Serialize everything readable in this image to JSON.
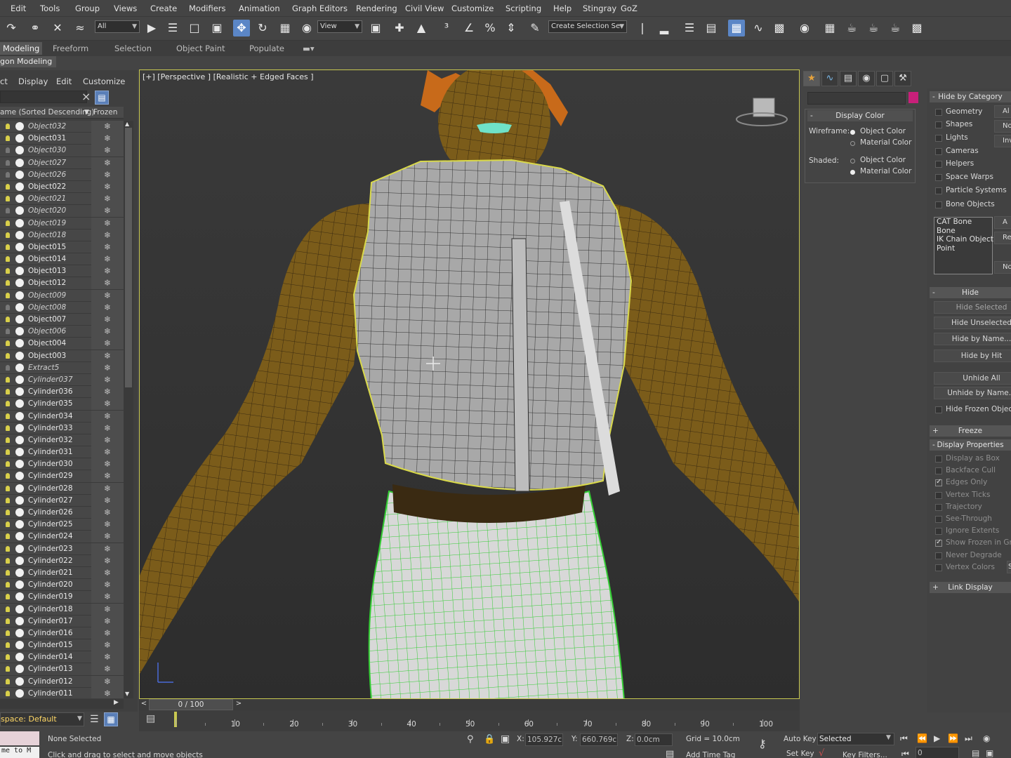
{
  "menu": [
    "Edit",
    "Tools",
    "Group",
    "Views",
    "Create",
    "Modifiers",
    "Animation",
    "Graph Editors",
    "Rendering",
    "Civil View",
    "Customize",
    "Scripting",
    "Help",
    "Stingray",
    "GoZ"
  ],
  "toolbar": {
    "selection_filter": "All",
    "ref_coord": "View",
    "named_selection_placeholder": "Create Selection Se"
  },
  "ribbon": {
    "tabs": [
      "Modeling",
      "Freeform",
      "Selection",
      "Object Paint",
      "Populate"
    ],
    "sub_panel": "gon Modeling"
  },
  "scene_explorer": {
    "menu": [
      "ct",
      "Display",
      "Edit",
      "Customize"
    ],
    "col_name": "ame (Sorted Descending)",
    "col_frozen": "Frozen",
    "rows": [
      {
        "name": "Object032",
        "italic": true,
        "on": true
      },
      {
        "name": "Object031",
        "italic": false,
        "on": true
      },
      {
        "name": "Object030",
        "italic": true,
        "on": false
      },
      {
        "name": "Object027",
        "italic": true,
        "on": false
      },
      {
        "name": "Object026",
        "italic": true,
        "on": false
      },
      {
        "name": "Object022",
        "italic": false,
        "on": true
      },
      {
        "name": "Object021",
        "italic": true,
        "on": true
      },
      {
        "name": "Object020",
        "italic": true,
        "on": false
      },
      {
        "name": "Object019",
        "italic": true,
        "on": true
      },
      {
        "name": "Object018",
        "italic": true,
        "on": true
      },
      {
        "name": "Object015",
        "italic": false,
        "on": true
      },
      {
        "name": "Object014",
        "italic": false,
        "on": true
      },
      {
        "name": "Object013",
        "italic": false,
        "on": true
      },
      {
        "name": "Object012",
        "italic": false,
        "on": true
      },
      {
        "name": "Object009",
        "italic": true,
        "on": true
      },
      {
        "name": "Object008",
        "italic": true,
        "on": false
      },
      {
        "name": "Object007",
        "italic": false,
        "on": true
      },
      {
        "name": "Object006",
        "italic": true,
        "on": false
      },
      {
        "name": "Object004",
        "italic": false,
        "on": true
      },
      {
        "name": "Object003",
        "italic": false,
        "on": true
      },
      {
        "name": "Extract5",
        "italic": true,
        "on": false
      },
      {
        "name": "Cylinder037",
        "italic": true,
        "on": true
      },
      {
        "name": "Cylinder036",
        "italic": false,
        "on": true
      },
      {
        "name": "Cylinder035",
        "italic": false,
        "on": true
      },
      {
        "name": "Cylinder034",
        "italic": false,
        "on": true
      },
      {
        "name": "Cylinder033",
        "italic": false,
        "on": true
      },
      {
        "name": "Cylinder032",
        "italic": false,
        "on": true
      },
      {
        "name": "Cylinder031",
        "italic": false,
        "on": true
      },
      {
        "name": "Cylinder030",
        "italic": false,
        "on": true
      },
      {
        "name": "Cylinder029",
        "italic": false,
        "on": true
      },
      {
        "name": "Cylinder028",
        "italic": false,
        "on": true
      },
      {
        "name": "Cylinder027",
        "italic": false,
        "on": true
      },
      {
        "name": "Cylinder026",
        "italic": false,
        "on": true
      },
      {
        "name": "Cylinder025",
        "italic": false,
        "on": true
      },
      {
        "name": "Cylinder024",
        "italic": false,
        "on": true
      },
      {
        "name": "Cylinder023",
        "italic": false,
        "on": true
      },
      {
        "name": "Cylinder022",
        "italic": false,
        "on": true
      },
      {
        "name": "Cylinder021",
        "italic": false,
        "on": true
      },
      {
        "name": "Cylinder020",
        "italic": false,
        "on": true
      },
      {
        "name": "Cylinder019",
        "italic": false,
        "on": true
      },
      {
        "name": "Cylinder018",
        "italic": false,
        "on": true
      },
      {
        "name": "Cylinder017",
        "italic": false,
        "on": true
      },
      {
        "name": "Cylinder016",
        "italic": false,
        "on": true
      },
      {
        "name": "Cylinder015",
        "italic": false,
        "on": true
      },
      {
        "name": "Cylinder014",
        "italic": false,
        "on": true
      },
      {
        "name": "Cylinder013",
        "italic": false,
        "on": true
      },
      {
        "name": "Cylinder012",
        "italic": false,
        "on": true
      },
      {
        "name": "Cylinder011",
        "italic": false,
        "on": true
      }
    ],
    "layer_label": "space: Default"
  },
  "viewport": {
    "label": "[+] [Perspective ] [Realistic + Edged Faces ]",
    "selection_color": "#c8c850",
    "subobject_color": "#33cc33"
  },
  "command_panel": {
    "object_color": "#c8207a",
    "display_color_title": "Display Color",
    "wireframe_label": "Wireframe:",
    "shaded_label": "Shaded:",
    "object_color_label": "Object Color",
    "material_color_label": "Material Color"
  },
  "display_panel": {
    "hide_by_category_title": "Hide by Category",
    "categories": [
      "Geometry",
      "Shapes",
      "Lights",
      "Cameras",
      "Helpers",
      "Space Warps",
      "Particle Systems",
      "Bone Objects"
    ],
    "category_buttons": [
      "Al",
      "No",
      "Inv"
    ],
    "cat_list": [
      "CAT Bone",
      "Bone",
      "IK Chain Object",
      "Point"
    ],
    "cat_list_buttons": [
      "A",
      "Rem",
      "No"
    ],
    "hide_title": "Hide",
    "hide_buttons": [
      "Hide Selected",
      "Hide Unselected",
      "Hide by Name...",
      "Hide by Hit",
      "Unhide All",
      "Unhide by Name..."
    ],
    "hide_frozen": "Hide Frozen Objects",
    "freeze_title": "Freeze",
    "display_props_title": "Display Properties",
    "display_props": [
      {
        "label": "Display as Box",
        "on": false
      },
      {
        "label": "Backface Cull",
        "on": false
      },
      {
        "label": "Edges Only",
        "on": true
      },
      {
        "label": "Vertex Ticks",
        "on": false
      },
      {
        "label": "Trajectory",
        "on": false
      },
      {
        "label": "See-Through",
        "on": false
      },
      {
        "label": "Ignore Extents",
        "on": false
      },
      {
        "label": "Show Frozen in Gray",
        "on": true
      },
      {
        "label": "Never Degrade",
        "on": false
      },
      {
        "label": "Vertex Colors",
        "on": false
      }
    ],
    "vertex_colors_btn": "Sh",
    "link_display_title": "Link Display"
  },
  "timeline": {
    "slider_label": "0 / 100",
    "ticks": [
      10,
      20,
      30,
      40,
      50,
      60,
      70,
      80,
      90,
      100
    ]
  },
  "status": {
    "selection": "None Selected",
    "prompt": "Click and drag to select and move objects",
    "maxscript": "me to M",
    "x_label": "X:",
    "x_value": "105.927cm",
    "y_label": "Y:",
    "y_value": "660.769cm",
    "z_label": "Z:",
    "z_value": "0.0cm",
    "grid": "Grid = 10.0cm",
    "auto_key": "Auto Key",
    "set_key": "Set Key",
    "key_set_value": "Selected",
    "key_filters": "Key Filters...",
    "add_time_tag": "Add Time Tag",
    "frame_value": "0"
  }
}
